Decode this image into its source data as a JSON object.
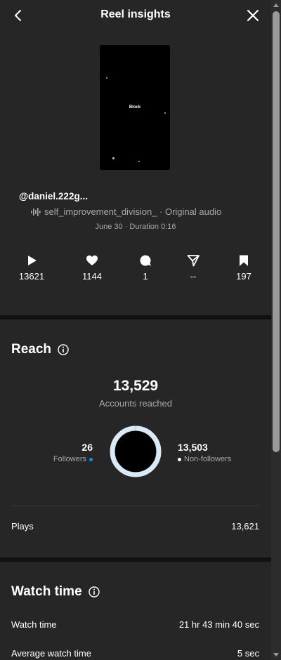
{
  "header": {
    "title": "Reel insights",
    "back_icon": "chevron-left-icon",
    "close_icon": "close-icon"
  },
  "reel": {
    "thumbnail_text": "Block",
    "username": "@daniel.222g...",
    "audio": "self_improvement_division_ · Original audio",
    "date_duration": "June 30 · Duration 0:16"
  },
  "stats": [
    {
      "icon": "play-icon",
      "value": "13621"
    },
    {
      "icon": "heart-icon",
      "value": "1144"
    },
    {
      "icon": "comment-icon",
      "value": "1"
    },
    {
      "icon": "share-icon",
      "value": "--"
    },
    {
      "icon": "bookmark-icon",
      "value": "197"
    }
  ],
  "reach": {
    "title": "Reach",
    "accounts_reached": "13,529",
    "accounts_reached_label": "Accounts reached",
    "followers_value": "26",
    "followers_label": "Followers",
    "non_followers_value": "13,503",
    "non_followers_label": "Non-followers",
    "followers_fraction": 0.0019,
    "plays_label": "Plays",
    "plays_value": "13,621"
  },
  "watch_time": {
    "title": "Watch time",
    "watch_time_label": "Watch time",
    "watch_time_value": "21 hr 43 min 40 sec",
    "avg_label": "Average watch time",
    "avg_value": "5 sec"
  },
  "colors": {
    "background": "#262626",
    "divider": "#111111",
    "followers_dot": "#0095f6",
    "non_followers_dot": "#ffffff",
    "donut_ring": "#dbe8f5",
    "secondary_text": "#a8a8a8"
  }
}
